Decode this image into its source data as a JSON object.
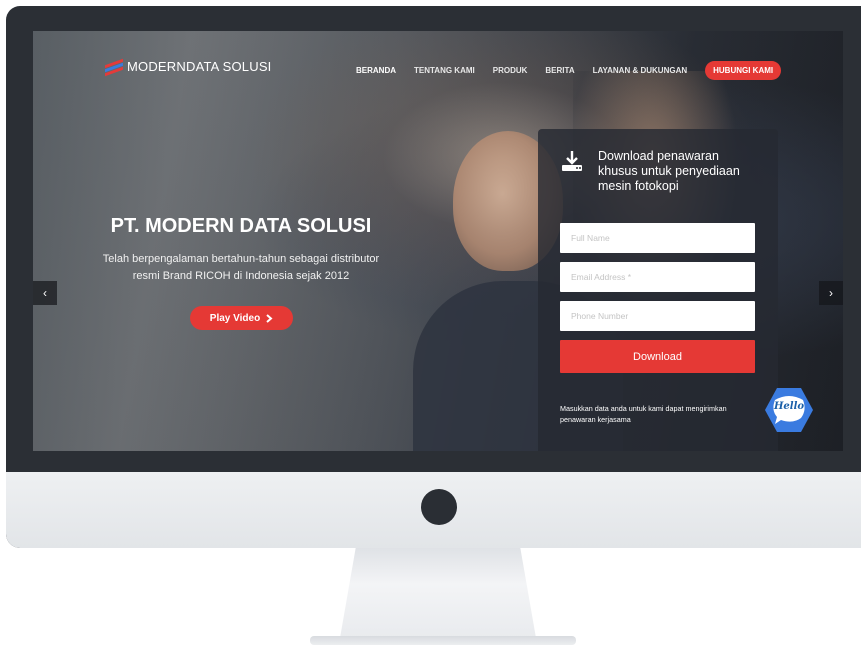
{
  "brand": {
    "name": "MODERNDATA SOLUSI",
    "colors": {
      "accent": "#e53935",
      "logo_blue": "#3a7be0"
    }
  },
  "nav": {
    "items": [
      "BERANDA",
      "TENTANG KAMI",
      "PRODUK",
      "BERITA",
      "LAYANAN & DUKUNGAN"
    ],
    "active": "BERANDA",
    "cta_label": "HUBUNGI KAMI"
  },
  "hero": {
    "title": "PT. MODERN DATA SOLUSI",
    "subtitle_line1": "Telah berpengalaman bertahun-tahun sebagai distributor",
    "subtitle_line2": "resmi Brand RICOH di Indonesia sejak 2012",
    "play_label": "Play Video",
    "play_icon": "chevron-right-icon"
  },
  "slider": {
    "prev_glyph": "‹",
    "next_glyph": "›"
  },
  "form": {
    "icon": "download-icon",
    "title_line1": "Download penawaran",
    "title_line2": "khusus untuk penyediaan",
    "title_line3": "mesin fotokopi",
    "fullname_placeholder": "Full Name",
    "email_placeholder": "Email Address *",
    "phone_placeholder": "Phone Number",
    "submit_label": "Download",
    "note_line1": "Masukkan data anda untuk kami dapat mengirimkan",
    "note_line2": "penawaran kerjasama"
  },
  "chat": {
    "label": "Hello",
    "icon": "hello-chat-icon"
  }
}
